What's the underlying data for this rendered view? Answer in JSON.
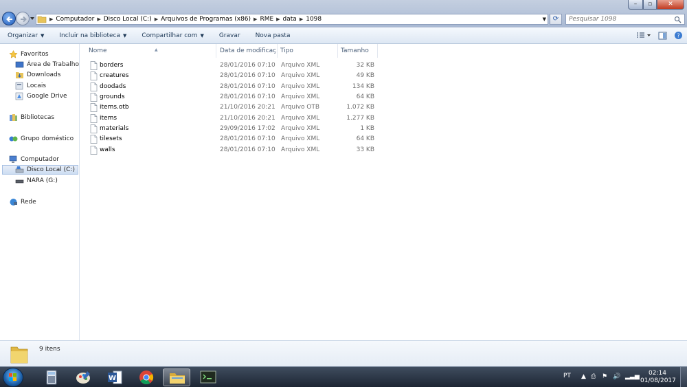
{
  "window": {
    "controls": {
      "minimize": "–",
      "maximize": "▫",
      "close": "✕"
    }
  },
  "address_bar": {
    "breadcrumbs": [
      "Computador",
      "Disco Local (C:)",
      "Arquivos de Programas (x86)",
      "RME",
      "data",
      "1098"
    ]
  },
  "search": {
    "placeholder": "Pesquisar 1098"
  },
  "toolbar": {
    "organize": "Organizar",
    "include_library": "Incluir na biblioteca",
    "share": "Compartilhar com",
    "burn": "Gravar",
    "new_folder": "Nova pasta"
  },
  "nav_pane": {
    "favorites": {
      "label": "Favoritos",
      "items": [
        "Área de Trabalho",
        "Downloads",
        "Locais",
        "Google Drive"
      ]
    },
    "libraries": "Bibliotecas",
    "homegroup": "Grupo doméstico",
    "computer": {
      "label": "Computador",
      "items": [
        "Disco Local (C:)",
        "NARA (G:)"
      ],
      "selected": "Disco Local (C:)"
    },
    "network": "Rede"
  },
  "columns": {
    "name": "Nome",
    "date": "Data de modificaç...",
    "type": "Tipo",
    "size": "Tamanho"
  },
  "files": [
    {
      "name": "borders",
      "date": "28/01/2016 07:10",
      "type": "Arquivo XML",
      "size": "32 KB"
    },
    {
      "name": "creatures",
      "date": "28/01/2016 07:10",
      "type": "Arquivo XML",
      "size": "49 KB"
    },
    {
      "name": "doodads",
      "date": "28/01/2016 07:10",
      "type": "Arquivo XML",
      "size": "134 KB"
    },
    {
      "name": "grounds",
      "date": "28/01/2016 07:10",
      "type": "Arquivo XML",
      "size": "64 KB"
    },
    {
      "name": "items.otb",
      "date": "21/10/2016 20:21",
      "type": "Arquivo OTB",
      "size": "1.072 KB"
    },
    {
      "name": "items",
      "date": "21/10/2016 20:21",
      "type": "Arquivo XML",
      "size": "1.277 KB"
    },
    {
      "name": "materials",
      "date": "29/09/2016 17:02",
      "type": "Arquivo XML",
      "size": "1 KB"
    },
    {
      "name": "tilesets",
      "date": "28/01/2016 07:10",
      "type": "Arquivo XML",
      "size": "64 KB"
    },
    {
      "name": "walls",
      "date": "28/01/2016 07:10",
      "type": "Arquivo XML",
      "size": "33 KB"
    }
  ],
  "details": {
    "count": "9 itens"
  },
  "taskbar": {
    "apps": [
      "calculator-icon",
      "paint-icon",
      "word-icon",
      "chrome-icon",
      "explorer-icon",
      "terminal-icon"
    ],
    "active_app": "explorer-icon",
    "language": "PT",
    "time": "02:14",
    "date": "01/08/2017"
  }
}
